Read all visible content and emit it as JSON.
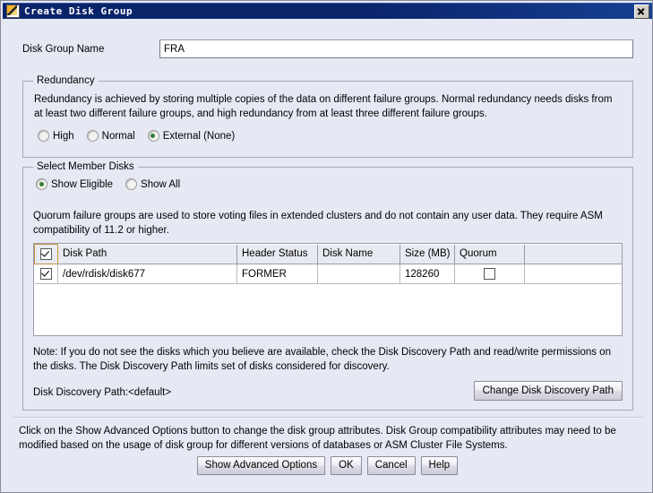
{
  "window": {
    "title": "Create Disk Group",
    "icon": "app-icon",
    "close_label": "✕"
  },
  "form": {
    "disk_group_name_label": "Disk Group Name",
    "disk_group_name_value": "FRA",
    "disk_group_name_placeholder": ""
  },
  "redundancy": {
    "group_title": "Redundancy",
    "description": "Redundancy is achieved by storing multiple copies of the data on different failure groups. Normal redundancy needs disks from at least two different failure groups, and high redundancy from at least three different failure groups.",
    "options": [
      {
        "label": "High",
        "selected": false
      },
      {
        "label": "Normal",
        "selected": false
      },
      {
        "label": "External (None)",
        "selected": true
      }
    ]
  },
  "member_disks": {
    "group_title": "Select Member Disks",
    "filter_options": [
      {
        "label": "Show Eligible",
        "selected": true
      },
      {
        "label": "Show All",
        "selected": false
      }
    ],
    "quorum_description": "Quorum failure groups are used to store voting files in extended clusters and do not contain any user data. They require ASM compatibility of 11.2 or higher.",
    "table": {
      "select_all_checked": true,
      "columns": [
        "Disk Path",
        "Header Status",
        "Disk Name",
        "Size (MB)",
        "Quorum"
      ],
      "rows": [
        {
          "selected": true,
          "disk_path": "/dev/rdisk/disk677",
          "header_status": "FORMER",
          "disk_name": "",
          "size_mb": "128260",
          "quorum": false
        }
      ]
    },
    "note": "Note: If you do not see the disks which you believe are available, check the Disk Discovery Path and read/write permissions on the disks. The Disk Discovery Path limits set of disks considered for discovery.",
    "discovery_path_label": "Disk Discovery Path:<default>",
    "change_path_button": "Change Disk Discovery Path"
  },
  "footer": {
    "description": "Click on the Show Advanced Options button to change the disk group attributes. Disk Group compatibility attributes may need to be modified based on the usage of disk group for different versions of databases or ASM Cluster File Systems.",
    "buttons": [
      {
        "label": "Show Advanced Options"
      },
      {
        "label": "OK"
      },
      {
        "label": "Cancel"
      },
      {
        "label": "Help"
      }
    ]
  },
  "colors": {
    "titlebar": "#0a246a",
    "background": "#e6e9f4",
    "radio_selected": "#2f7d32",
    "focus_border": "#c79340"
  }
}
